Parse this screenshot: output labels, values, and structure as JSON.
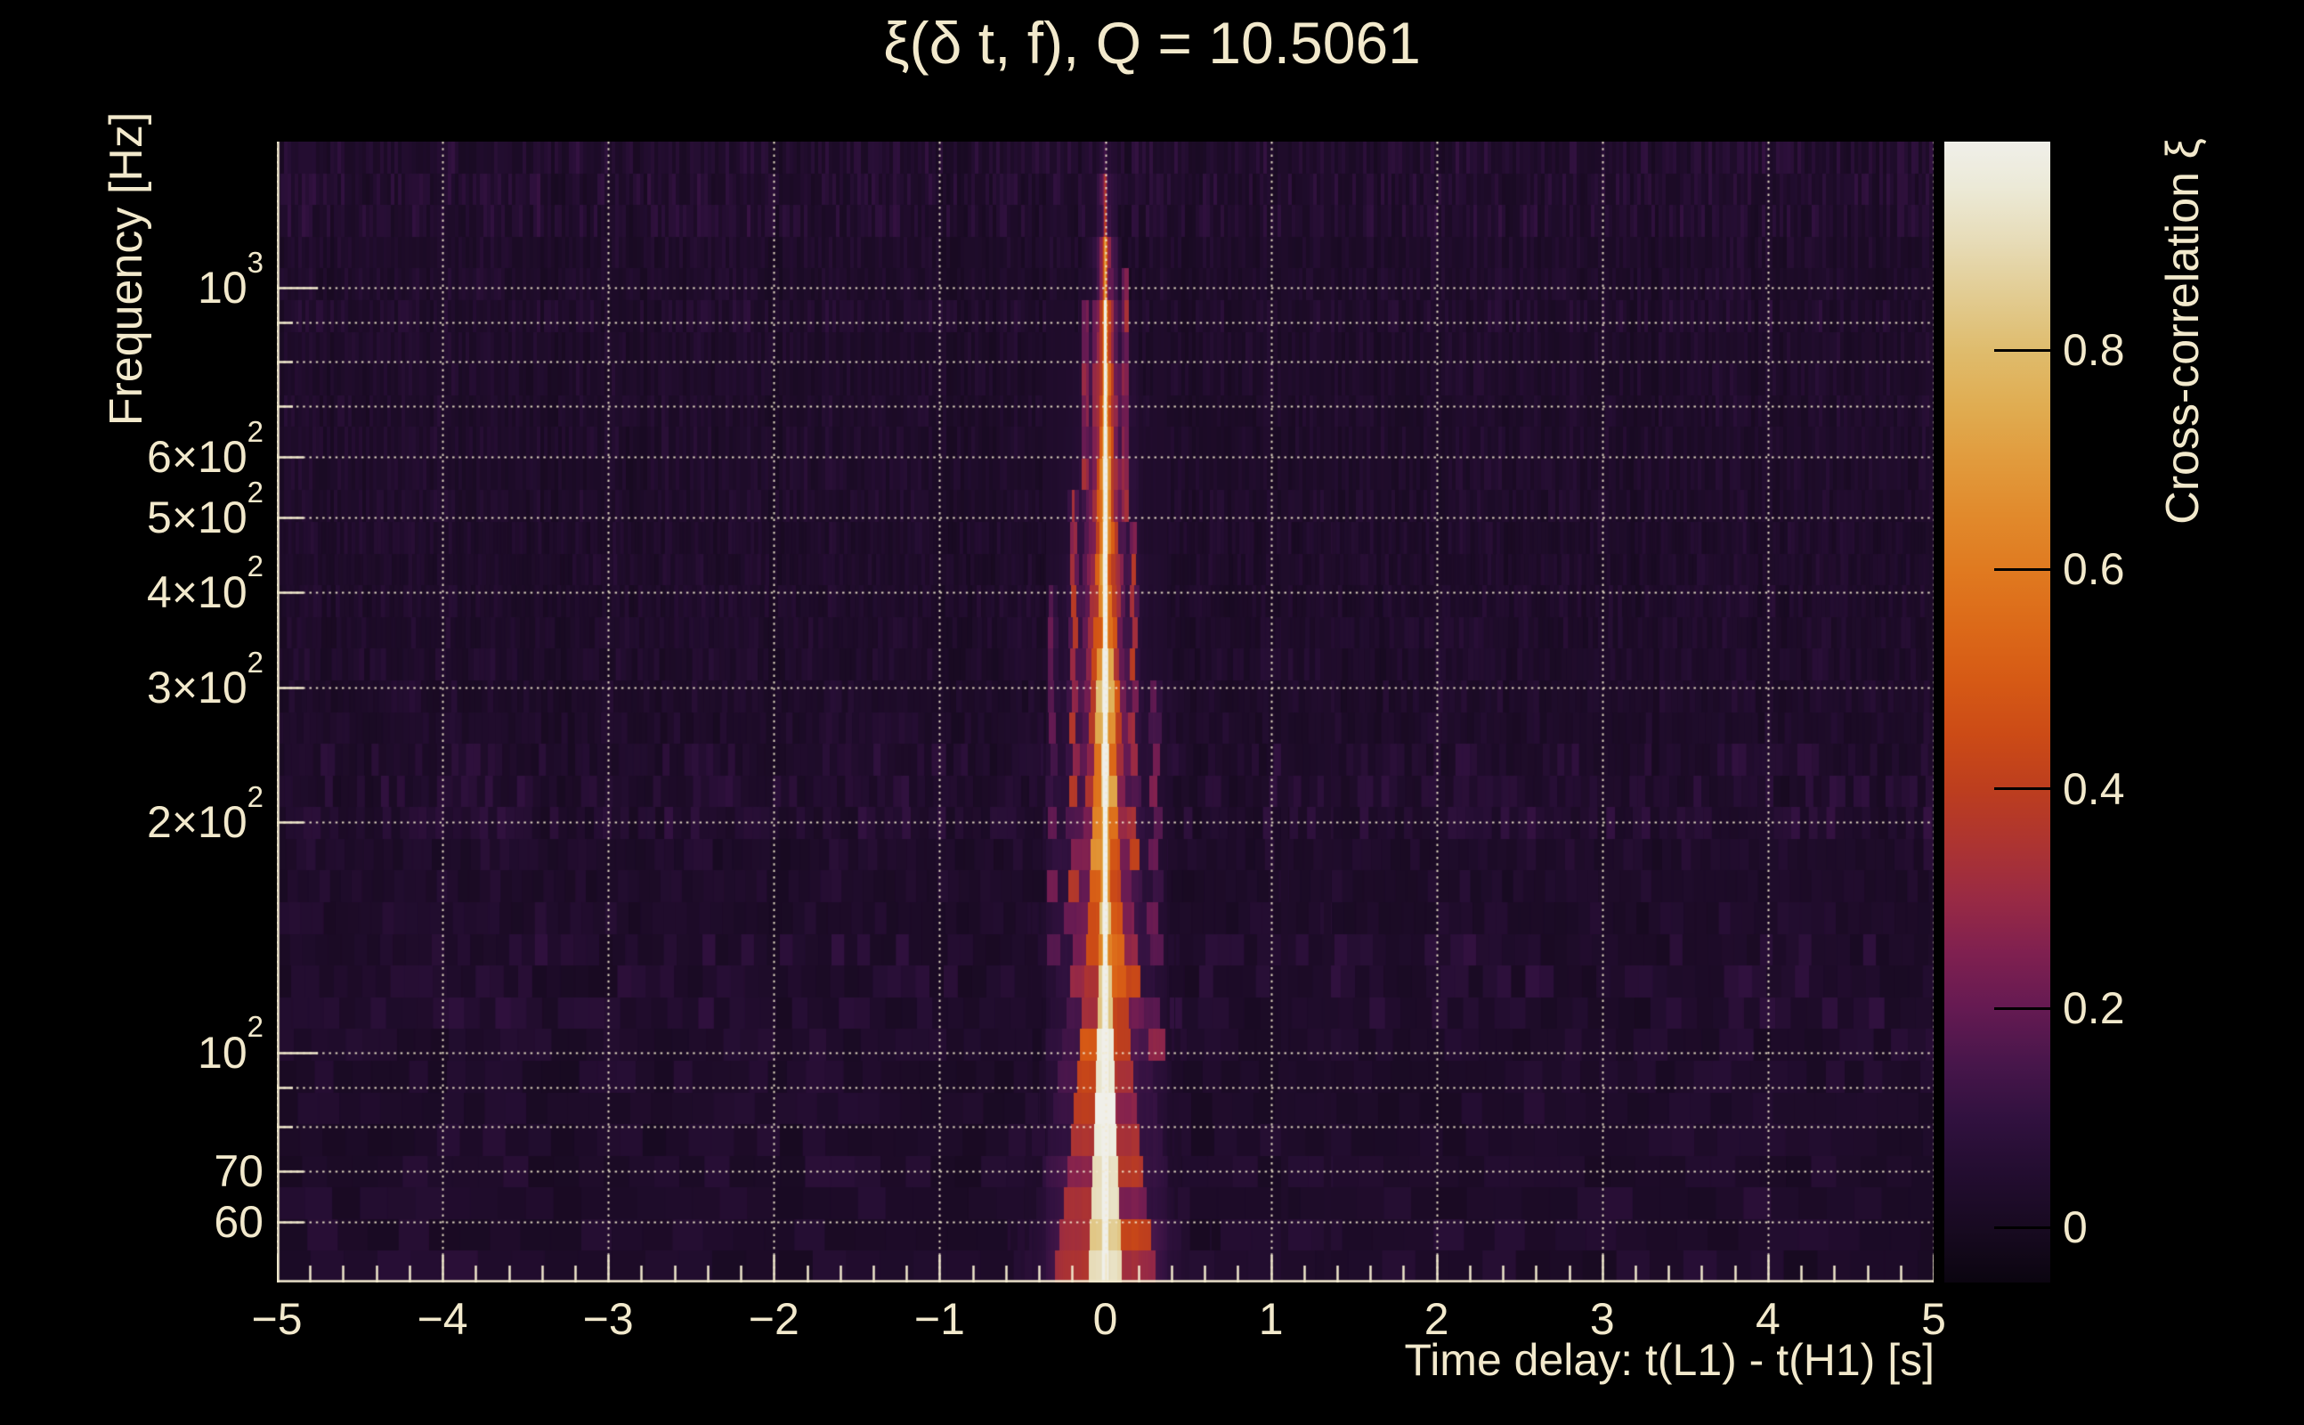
{
  "title": "ξ(δ t, f), Q = 10.5061",
  "colors": {
    "background": "#000000",
    "text": "#f2e9cc",
    "grid": "#efe6c8",
    "axis": "#f0e8cc",
    "colorbar_tick": "#000000"
  },
  "chart_data": {
    "type": "heatmap",
    "title": "ξ(δ t, f), Q = 10.5061",
    "q_value": 10.5061,
    "xlabel": "Time delay: t(L1) - t(H1) [s]",
    "ylabel": "Frequency [Hz]",
    "colorbar_label": "Cross-correlation ξ",
    "x_range": [
      -5,
      5
    ],
    "x_minor_step": 0.2,
    "x_ticks": [
      {
        "v": -5,
        "label": "−5"
      },
      {
        "v": -4,
        "label": "−4"
      },
      {
        "v": -3,
        "label": "−3"
      },
      {
        "v": -2,
        "label": "−2"
      },
      {
        "v": -1,
        "label": "−1"
      },
      {
        "v": 0,
        "label": "0"
      },
      {
        "v": 1,
        "label": "1"
      },
      {
        "v": 2,
        "label": "2"
      },
      {
        "v": 3,
        "label": "3"
      },
      {
        "v": 4,
        "label": "4"
      },
      {
        "v": 5,
        "label": "5"
      }
    ],
    "y_scale": "log",
    "y_range_hz": [
      50,
      1552
    ],
    "y_ticks": [
      {
        "f": 1000,
        "label": "10^3",
        "major": true
      },
      {
        "f": 600,
        "label": "6×10^2",
        "major": false
      },
      {
        "f": 500,
        "label": "5×10^2",
        "major": false
      },
      {
        "f": 400,
        "label": "4×10^2",
        "major": false
      },
      {
        "f": 300,
        "label": "3×10^2",
        "major": false
      },
      {
        "f": 200,
        "label": "2×10^2",
        "major": false
      },
      {
        "f": 100,
        "label": "10^2",
        "major": true
      },
      {
        "f": 70,
        "label": "70",
        "major": false
      },
      {
        "f": 60,
        "label": "60",
        "major": false
      }
    ],
    "y_minor_gridlines_hz": [
      900,
      800,
      700,
      90,
      80
    ],
    "grid": true,
    "legend_position": "right-colorbar",
    "colorbar": {
      "min": -0.05,
      "max": 0.99,
      "ticks": [
        {
          "v": 0,
          "label": "0"
        },
        {
          "v": 0.2,
          "label": "0.2"
        },
        {
          "v": 0.4,
          "label": "0.4"
        },
        {
          "v": 0.6,
          "label": "0.6"
        },
        {
          "v": 0.8,
          "label": "0.8"
        }
      ]
    },
    "colormap_stops": [
      [
        -0.05,
        "#0b0510"
      ],
      [
        0.0,
        "#180a21"
      ],
      [
        0.05,
        "#230d30"
      ],
      [
        0.1,
        "#31113f"
      ],
      [
        0.15,
        "#48164b"
      ],
      [
        0.2,
        "#651a52"
      ],
      [
        0.25,
        "#7f2050"
      ],
      [
        0.3,
        "#992a44"
      ],
      [
        0.35,
        "#ad3431"
      ],
      [
        0.4,
        "#bd3e1e"
      ],
      [
        0.45,
        "#cc4b16"
      ],
      [
        0.5,
        "#d65a15"
      ],
      [
        0.55,
        "#dc6a19"
      ],
      [
        0.6,
        "#e07a20"
      ],
      [
        0.65,
        "#e18a2c"
      ],
      [
        0.7,
        "#e19b3d"
      ],
      [
        0.75,
        "#e0ad52"
      ],
      [
        0.8,
        "#dfbc6d"
      ],
      [
        0.85,
        "#e2cc92"
      ],
      [
        0.9,
        "#e7dcb8"
      ],
      [
        0.95,
        "#ecead8"
      ],
      [
        0.99,
        "#f0efe9"
      ]
    ],
    "peak": {
      "t_delay_s": 0.0,
      "xi_max": 0.99
    },
    "ridge_bands": [
      {
        "f_max_hz": 58,
        "core_xi": 0.99,
        "halo_xi": 0.7,
        "sigma_s": 0.13,
        "pedestal_xi": 0.12
      },
      {
        "f_max_hz": 75,
        "core_xi": 0.99,
        "halo_xi": 0.68,
        "sigma_s": 0.11,
        "pedestal_xi": 0.08
      },
      {
        "f_max_hz": 105,
        "core_xi": 0.985,
        "halo_xi": 0.64,
        "sigma_s": 0.1,
        "pedestal_xi": 0.05
      },
      {
        "f_max_hz": 150,
        "core_xi": 0.97,
        "halo_xi": 0.58,
        "sigma_s": 0.092,
        "pedestal_xi": 0.04
      },
      {
        "f_max_hz": 210,
        "core_xi": 0.96,
        "halo_xi": 0.56,
        "sigma_s": 0.085,
        "pedestal_xi": 0.035
      },
      {
        "f_max_hz": 300,
        "core_xi": 0.94,
        "halo_xi": 0.54,
        "sigma_s": 0.08,
        "pedestal_xi": 0.03
      },
      {
        "f_max_hz": 430,
        "core_xi": 0.92,
        "halo_xi": 0.5,
        "sigma_s": 0.072,
        "pedestal_xi": 0.025
      },
      {
        "f_max_hz": 600,
        "core_xi": 0.9,
        "halo_xi": 0.46,
        "sigma_s": 0.066,
        "pedestal_xi": 0.02
      },
      {
        "f_max_hz": 820,
        "core_xi": 0.85,
        "halo_xi": 0.4,
        "sigma_s": 0.06,
        "pedestal_xi": 0.015
      },
      {
        "f_max_hz": 1000,
        "core_xi": 0.72,
        "halo_xi": 0.3,
        "sigma_s": 0.055,
        "pedestal_xi": 0.01
      },
      {
        "f_max_hz": 1180,
        "core_xi": 0.5,
        "halo_xi": 0.2,
        "sigma_s": 0.05,
        "pedestal_xi": 0.0
      },
      {
        "f_max_hz": 1380,
        "core_xi": 0.26,
        "halo_xi": 0.1,
        "sigma_s": 0.05,
        "pedestal_xi": 0.0
      },
      {
        "f_max_hz": 1600,
        "core_xi": 0.09,
        "halo_xi": 0.04,
        "sigma_s": 0.05,
        "pedestal_xi": 0.0
      }
    ],
    "streaks": [
      {
        "t_s": -0.19,
        "f_lo_hz": 120,
        "f_hi_hz": 520,
        "amp_xi": 0.3,
        "width_s": 0.018
      },
      {
        "t_s": 0.17,
        "f_lo_hz": 110,
        "f_hi_hz": 480,
        "amp_xi": 0.28,
        "width_s": 0.016
      },
      {
        "t_s": 0.3,
        "f_lo_hz": 95,
        "f_hi_hz": 300,
        "amp_xi": 0.22,
        "width_s": 0.02
      },
      {
        "t_s": -0.32,
        "f_lo_hz": 130,
        "f_hi_hz": 420,
        "amp_xi": 0.18,
        "width_s": 0.02
      },
      {
        "t_s": 0.12,
        "f_lo_hz": 480,
        "f_hi_hz": 1050,
        "amp_xi": 0.35,
        "width_s": 0.013
      },
      {
        "t_s": -0.12,
        "f_lo_hz": 520,
        "f_hi_hz": 980,
        "amp_xi": 0.3,
        "width_s": 0.013
      }
    ],
    "noise": {
      "seed": 1337,
      "rows": 36,
      "base_xi": 0.012,
      "default_amp_xi": 0.05,
      "tile_time_factor": 10.6,
      "bright_rows_hz": [
        [
          1150,
          1500,
          0.09
        ],
        [
          840,
          1000,
          0.07
        ],
        [
          185,
          250,
          0.085
        ],
        [
          105,
          148,
          0.08
        ]
      ]
    }
  }
}
